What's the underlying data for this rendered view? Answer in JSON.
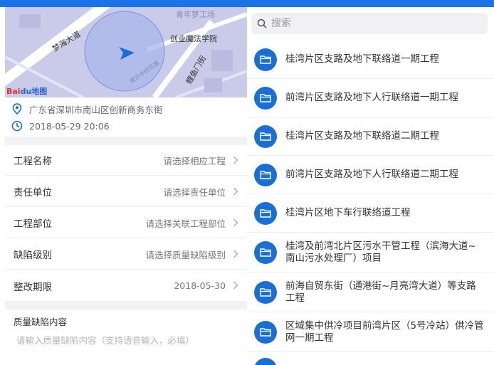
{
  "map": {
    "labels": [
      "梦海大道",
      "创业魔法学院",
      "鲤鱼门街",
      "青年梦工场"
    ],
    "radius_label": "提示半径范围",
    "logo_a": "Bai",
    "logo_b": "du地图"
  },
  "info": {
    "location": "广东省深圳市南山区创新商务东街",
    "datetime": "2018-05-29 20:06"
  },
  "form": {
    "rows": [
      {
        "label": "工程名称",
        "value": "请选择相应工程"
      },
      {
        "label": "责任单位",
        "value": "请选择责任单位"
      },
      {
        "label": "工程部位",
        "value": "请选择关联工程部位"
      },
      {
        "label": "缺陷级别",
        "value": "请选择质量缺陷级别"
      },
      {
        "label": "整改期限",
        "value": "2018-05-30"
      }
    ],
    "content_label": "质量缺陷内容",
    "content_placeholder": "请输入质量缺陷内容（支持语音输入，必填）"
  },
  "search": {
    "placeholder": "搜索"
  },
  "projects": [
    {
      "title": "桂湾片区支路及地下联络道一期工程"
    },
    {
      "title": "前湾片区支路及地下人行联络道一期工程"
    },
    {
      "title": "桂湾片区支路及地下联络道二期工程"
    },
    {
      "title": "前湾片区支路及地下人行联络道二期工程"
    },
    {
      "title": "桂湾片区地下车行联络道工程"
    },
    {
      "title": "桂湾及前湾北片区污水干管工程（滨海大道~南山污水处理厂）项目"
    },
    {
      "title": "前海自贸东街（通港街~月亮湾大道）等支路工程"
    },
    {
      "title": "区域集中供冷项目前湾片区（5号冷站）供冷管网一期工程"
    }
  ],
  "colors": {
    "accent": "#1a73e8",
    "folder_circle": "#1a6fd6",
    "map_bg": "#c9cbe8"
  }
}
